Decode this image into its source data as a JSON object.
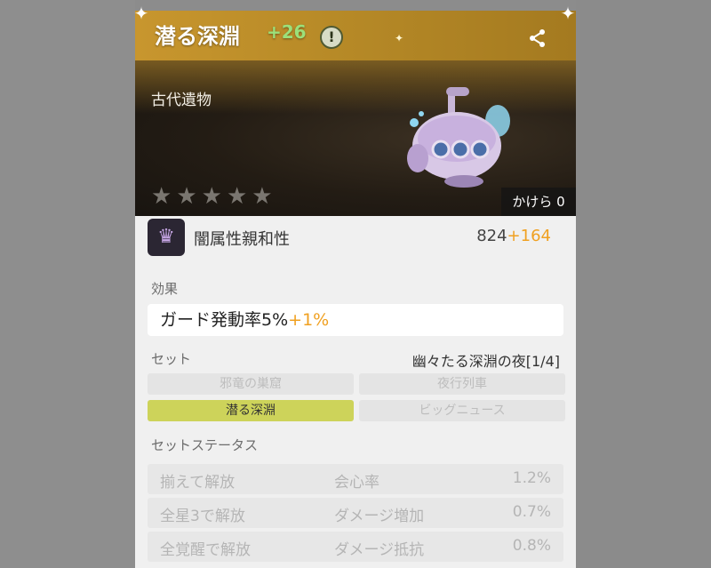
{
  "header": {
    "title": "潜る深淵",
    "level_bonus": "+26",
    "info_icon": "exclamation-icon",
    "share_icon": "share-icon"
  },
  "banner": {
    "category": "古代遺物",
    "stars_total": 5,
    "stars_filled": 0,
    "fragments_label": "かけら 0"
  },
  "affinity": {
    "label": "闇属性親和性",
    "base": "824",
    "bonus": "+164"
  },
  "effect": {
    "section_label": "効果",
    "text": "ガード発動率5%",
    "bonus": "+1%"
  },
  "set": {
    "section_label": "セット",
    "set_name": "幽々たる深淵の夜[1/4]",
    "items": [
      {
        "label": "邪竜の巣窟",
        "active": false
      },
      {
        "label": "夜行列車",
        "active": false
      },
      {
        "label": "潜る深淵",
        "active": true
      },
      {
        "label": "ビッグニュース",
        "active": false
      }
    ]
  },
  "set_status": {
    "section_label": "セットステータス",
    "rows": [
      {
        "condition": "揃えて解放",
        "stat": "会心率",
        "value": "1.2%"
      },
      {
        "condition": "全星3で解放",
        "stat": "ダメージ増加",
        "value": "0.7%"
      },
      {
        "condition": "全覚醒で解放",
        "stat": "ダメージ抵抗",
        "value": "0.8%"
      }
    ]
  },
  "colors": {
    "header_gold": "#c8962e",
    "bonus_orange": "#f0a020",
    "level_green": "#9be07a",
    "active_set": "#cdd35a"
  }
}
